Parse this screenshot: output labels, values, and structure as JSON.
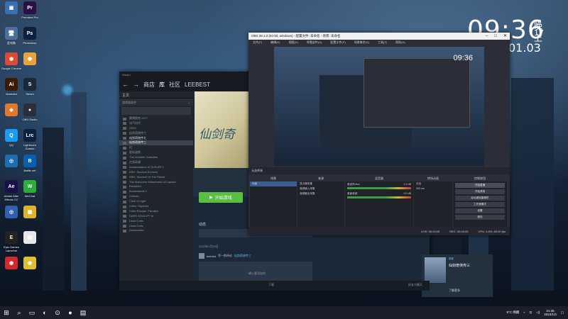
{
  "desktop": {
    "icons": [
      {
        "label": "",
        "glyph": "▣",
        "color": "#3a6fb0"
      },
      {
        "label": "Premiere Pro",
        "glyph": "Pr",
        "color": "#2a0f48"
      },
      {
        "label": "此电脑",
        "glyph": "🖥",
        "color": "#4a6f9a"
      },
      {
        "label": "Photoshop",
        "glyph": "Ps",
        "color": "#0b2140"
      },
      {
        "label": "Google Chrome",
        "glyph": "◉",
        "color": "#d94a38"
      },
      {
        "label": "",
        "glyph": "◉",
        "color": "#e8a33a"
      },
      {
        "label": "Illustrator",
        "glyph": "Ai",
        "color": "#3a1a00"
      },
      {
        "label": "Steam",
        "glyph": "S",
        "color": "#1b2838"
      },
      {
        "label": "",
        "glyph": "◆",
        "color": "#e07a2a"
      },
      {
        "label": "OBS Studio",
        "glyph": "●",
        "color": "#2b2e38"
      },
      {
        "label": "QQ",
        "glyph": "Q",
        "color": "#1a9af0"
      },
      {
        "label": "Lightroom Classic",
        "glyph": "Lrc",
        "color": "#0b2140"
      },
      {
        "label": "",
        "glyph": "◎",
        "color": "#1a6fb0"
      },
      {
        "label": "Battle.net",
        "glyph": "B",
        "color": "#0a5eb0"
      },
      {
        "label": "Adobe After Effects CC",
        "glyph": "Ae",
        "color": "#1a0f48"
      },
      {
        "label": "WeChat",
        "glyph": "W",
        "color": "#2aae3a"
      },
      {
        "label": "",
        "glyph": "◎",
        "color": "#3060b0"
      },
      {
        "label": "",
        "glyph": "▦",
        "color": "#e0b22a"
      },
      {
        "label": "Epic Games Launcher",
        "glyph": "E",
        "color": "#222"
      },
      {
        "label": "",
        "glyph": "▤",
        "color": "#e8e8e8"
      },
      {
        "label": "",
        "glyph": "◉",
        "color": "#d02a2a"
      },
      {
        "label": "",
        "glyph": "◉",
        "color": "#e0c030"
      }
    ],
    "clock": {
      "time": "09:36",
      "ampm": "晚上",
      "day": "17",
      "date": "01.03"
    }
  },
  "steam": {
    "topbar": "Steam",
    "nav": {
      "back": "←",
      "forward": "→",
      "store": "商店",
      "library": "库",
      "community": "社区",
      "username": "LEEBEST"
    },
    "sidebar": {
      "home": "主页",
      "filter": "游戏和软件",
      "games": [
        {
          "name": "赛博朋克 2077",
          "installed": false
        },
        {
          "name": "冰汽时代",
          "installed": false
        },
        {
          "name": "GRIS",
          "installed": false
        },
        {
          "name": "仙剑奇侠传六",
          "installed": false
        },
        {
          "name": "仙剑奇侠传七",
          "installed": true
        },
        {
          "name": "仙剑奇侠传三",
          "installed": true,
          "selected": true
        },
        {
          "name": "幻",
          "installed": false
        },
        {
          "name": "星际迷航",
          "installed": false
        },
        {
          "name": "The Invisible Guardian",
          "installed": false
        },
        {
          "name": "古剑奇谭",
          "installed": false
        },
        {
          "name": "Assassination of SUZURI 2",
          "installed": false
        },
        {
          "name": "ARK: Survival Evolved",
          "installed": false
        },
        {
          "name": "ARK: Survival Of The Fittest",
          "installed": false
        },
        {
          "name": "The Awesome Adventures of Captain",
          "installed": false
        },
        {
          "name": "Banished",
          "installed": false
        },
        {
          "name": "Borderlands 2",
          "installed": false
        },
        {
          "name": "Celeste",
          "installed": false
        },
        {
          "name": "Child of Light",
          "installed": false
        },
        {
          "name": "Cities: Skylines",
          "installed": false
        },
        {
          "name": "Cube Escape: Paradox",
          "installed": false
        },
        {
          "name": "DARK SOULS™ III",
          "installed": false
        },
        {
          "name": "Dead Cells",
          "installed": false
        },
        {
          "name": "Dead Cells",
          "installed": false
        },
        {
          "name": "Dishonored",
          "installed": false
        }
      ],
      "add_game": "添加游戏"
    },
    "main": {
      "hero_logo": "仙剑奇",
      "play_button": "开始游戏",
      "activity_title": "动态",
      "activity_placeholder": "",
      "date": "2022年1月28日",
      "post_user": "leebest",
      "post_text": "写一则评论",
      "post_game": "仙剑奇侠传三",
      "comment_placeholder": "输入要添加的",
      "news": {
        "source": "更新",
        "title": "仙剑奇侠传三",
        "body": "",
        "read_more": "了解更多"
      }
    },
    "footer": {
      "downloads": "下载",
      "friends": "好友与聊天"
    }
  },
  "obs": {
    "title": "OBS 28.1.2 (64-bit, windows) - 配置文件: 未命名 - 场景: 未命名",
    "menu": [
      "文件(F)",
      "编辑(E)",
      "视图(V)",
      "停靠部件(D)",
      "配置文件(P)",
      "场景集合(S)",
      "工具(T)",
      "帮助(H)"
    ],
    "preview_clock": "09:36",
    "toolbar": "无选择源",
    "docks": {
      "scenes": {
        "title": "场景",
        "items": [
          "场景"
        ]
      },
      "sources": {
        "title": "来源",
        "items": [
          "显示器采集",
          "音频输入采集",
          "音频输出采集"
        ]
      },
      "mixer": {
        "title": "混音器",
        "channels": [
          {
            "name": "麦克风/Aux",
            "db": "0.0 dB"
          },
          {
            "name": "桌面音频",
            "db": "0.0 dB"
          }
        ]
      },
      "transitions": {
        "title": "转场动画",
        "type": "淡出",
        "duration": "300 ms"
      },
      "controls": {
        "title": "控制按钮",
        "buttons": [
          "开始直播",
          "开始录制",
          "启动虚拟摄像机",
          "工作室模式",
          "设置",
          "退出"
        ]
      }
    },
    "status": {
      "live": "LIVE: 00:00:00",
      "rec": "REC: 00:00:00",
      "cpu": "CPU: 4.8%, 60.00 fps"
    }
  },
  "taskbar": {
    "weather": "9°C 晴朗",
    "time": "21:36",
    "date": "2023/1/3"
  }
}
